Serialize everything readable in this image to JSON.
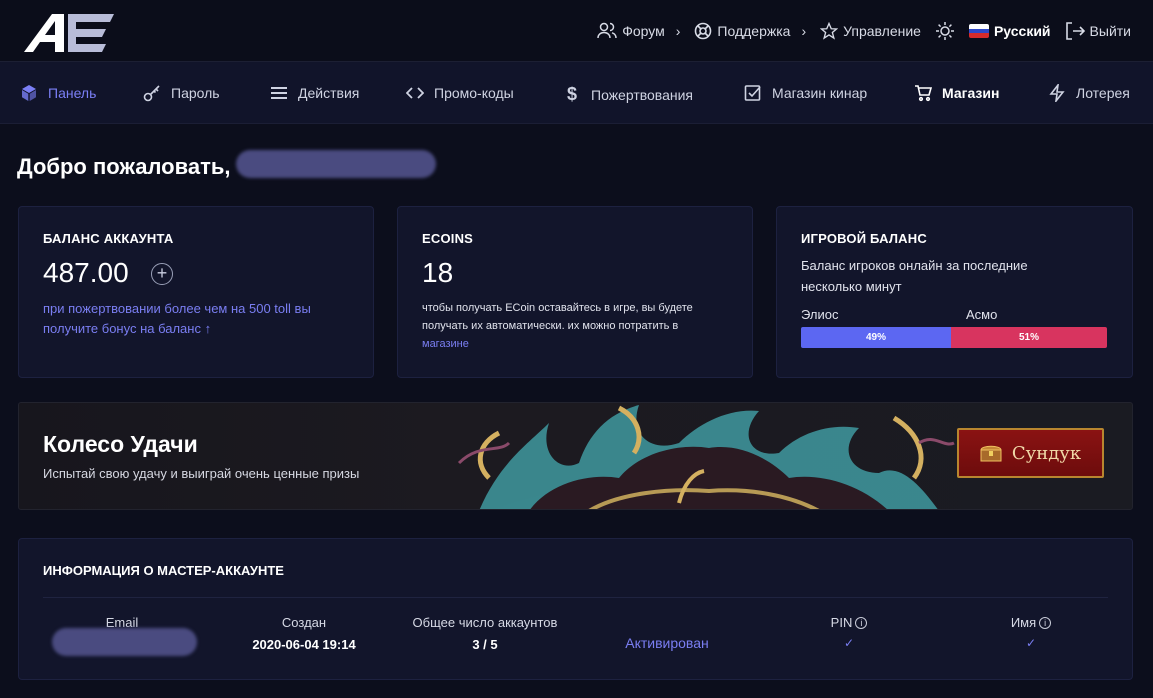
{
  "topbar": {
    "logo_text": "AE",
    "forum": "Форум",
    "support": "Поддержка",
    "manage": "Управление",
    "language": "Русский",
    "logout": "Выйти"
  },
  "mainnav": {
    "items": [
      {
        "label": "Панель",
        "icon": "cube-icon",
        "state": "active"
      },
      {
        "label": "Пароль",
        "icon": "key-icon",
        "state": ""
      },
      {
        "label": "Действия",
        "icon": "list-icon",
        "state": ""
      },
      {
        "label": "Промо-коды",
        "icon": "code-icon",
        "state": ""
      },
      {
        "label": "Пожертвования",
        "icon": "dollar-icon",
        "state": ""
      },
      {
        "label": "Магазин кинар",
        "icon": "check-square-icon",
        "state": ""
      },
      {
        "label": "Магазин",
        "icon": "cart-icon",
        "state": "bold"
      },
      {
        "label": "Лотерея",
        "icon": "bolt-icon",
        "state": ""
      }
    ]
  },
  "welcome": "Добро пожаловать,",
  "cards": {
    "balance": {
      "title": "БАЛАНС АККАУНТА",
      "value": "487.00",
      "note": "при пожертвовании более чем на 500 toll вы получите бонус на баланс ↑"
    },
    "ecoins": {
      "title": "ECOINS",
      "value": "18",
      "note": "чтобы получать ECoin оставайтесь в игре, вы будете получать их автоматически. их можно потратить в",
      "link": "магазине"
    },
    "game": {
      "title": "ИГРОВОЙ БАЛАНС",
      "desc": "Баланс игроков онлайн за последние несколько минут",
      "faction1": "Элиос",
      "faction2": "Асмо",
      "pct1_label": "49%",
      "pct2_label": "51%",
      "pct1": 49,
      "pct2": 51,
      "color1": "#5c67f2",
      "color2": "#d8345f"
    }
  },
  "banner": {
    "title": "Колесо Удачи",
    "subtitle": "Испытай свою удачу и выиграй очень ценные призы",
    "button": "Сундук"
  },
  "info": {
    "title": "ИНФОРМАЦИЯ О МАСТЕР-АККАУНТЕ",
    "email_label": "Email",
    "created_label": "Создан",
    "created_value": "2020-06-04 19:14",
    "accounts_label": "Общее число аккаунтов",
    "accounts_value": "3 / 5",
    "status": "Активирован",
    "pin_label": "PIN",
    "name_label": "Имя"
  },
  "colors": {
    "accent": "#7a7ef2",
    "background": "#0c0e1c",
    "card": "#12152b"
  }
}
